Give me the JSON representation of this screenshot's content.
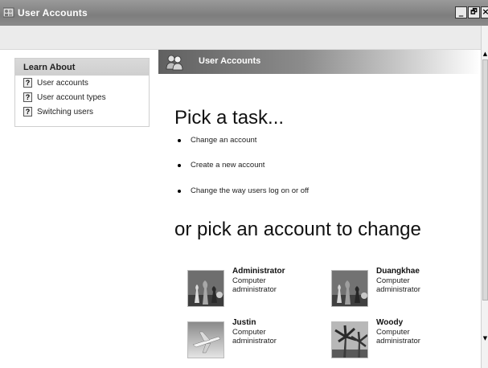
{
  "window": {
    "title": "User Accounts",
    "icon": "user-accounts-icon",
    "controls": {
      "minimize": "_",
      "maximize": "🗗",
      "close": "×"
    }
  },
  "sidebar": {
    "learn_about": {
      "title": "Learn About",
      "items": [
        {
          "label": "User accounts",
          "icon": "help-icon"
        },
        {
          "label": "User account types",
          "icon": "help-icon"
        },
        {
          "label": "Switching users",
          "icon": "help-icon"
        }
      ]
    }
  },
  "main": {
    "header_title": "User Accounts",
    "pick_task_heading": "Pick a task...",
    "tasks": [
      {
        "label": "Change an account"
      },
      {
        "label": "Create a new account"
      },
      {
        "label": "Change the way users log on or off"
      }
    ],
    "pick_account_heading": "or pick an account to change",
    "accounts": [
      {
        "name": "Administrator",
        "role": "Computer administrator",
        "picture": "chess-pieces"
      },
      {
        "name": "Duangkhae",
        "role": "Computer administrator",
        "picture": "chess-pieces"
      },
      {
        "name": "Justin",
        "role": "Computer administrator",
        "picture": "airplane"
      },
      {
        "name": "Woody",
        "role": "Computer administrator",
        "picture": "palm-trees"
      }
    ]
  }
}
